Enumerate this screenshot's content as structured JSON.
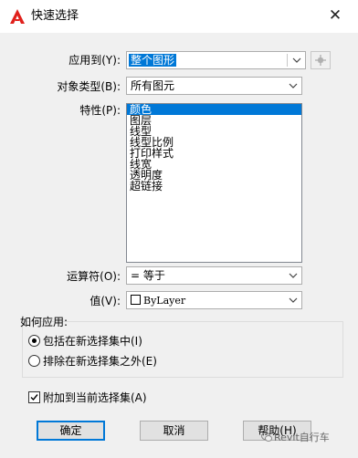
{
  "window": {
    "title": "快速选择",
    "close_glyph": "✕"
  },
  "form": {
    "apply_to": {
      "label": "应用到(Y):",
      "value": "整个图形"
    },
    "object_type": {
      "label": "对象类型(B):",
      "value": "所有图元"
    },
    "properties": {
      "label": "特性(P):",
      "items": [
        "颜色",
        "图层",
        "线型",
        "线型比例",
        "打印样式",
        "线宽",
        "透明度",
        "超链接"
      ],
      "selected_index": 0
    },
    "operator": {
      "label": "运算符(O):",
      "value": "= 等于"
    },
    "value": {
      "label": "值(V):",
      "value": "ByLayer",
      "swatch_color": "#ffffff"
    }
  },
  "how_to_apply": {
    "label": "如何应用:",
    "options": [
      {
        "label": "包括在新选择集中(I)",
        "checked": true
      },
      {
        "label": "排除在新选择集之外(E)",
        "checked": false
      }
    ]
  },
  "append_checkbox": {
    "label": "附加到当前选择集(A)",
    "checked": true
  },
  "buttons": {
    "ok": "确定",
    "cancel": "取消",
    "help": "帮助(H)"
  },
  "watermark": "Revit自行车",
  "colors": {
    "accent": "#0078d7",
    "logo_red": "#e0201b"
  }
}
